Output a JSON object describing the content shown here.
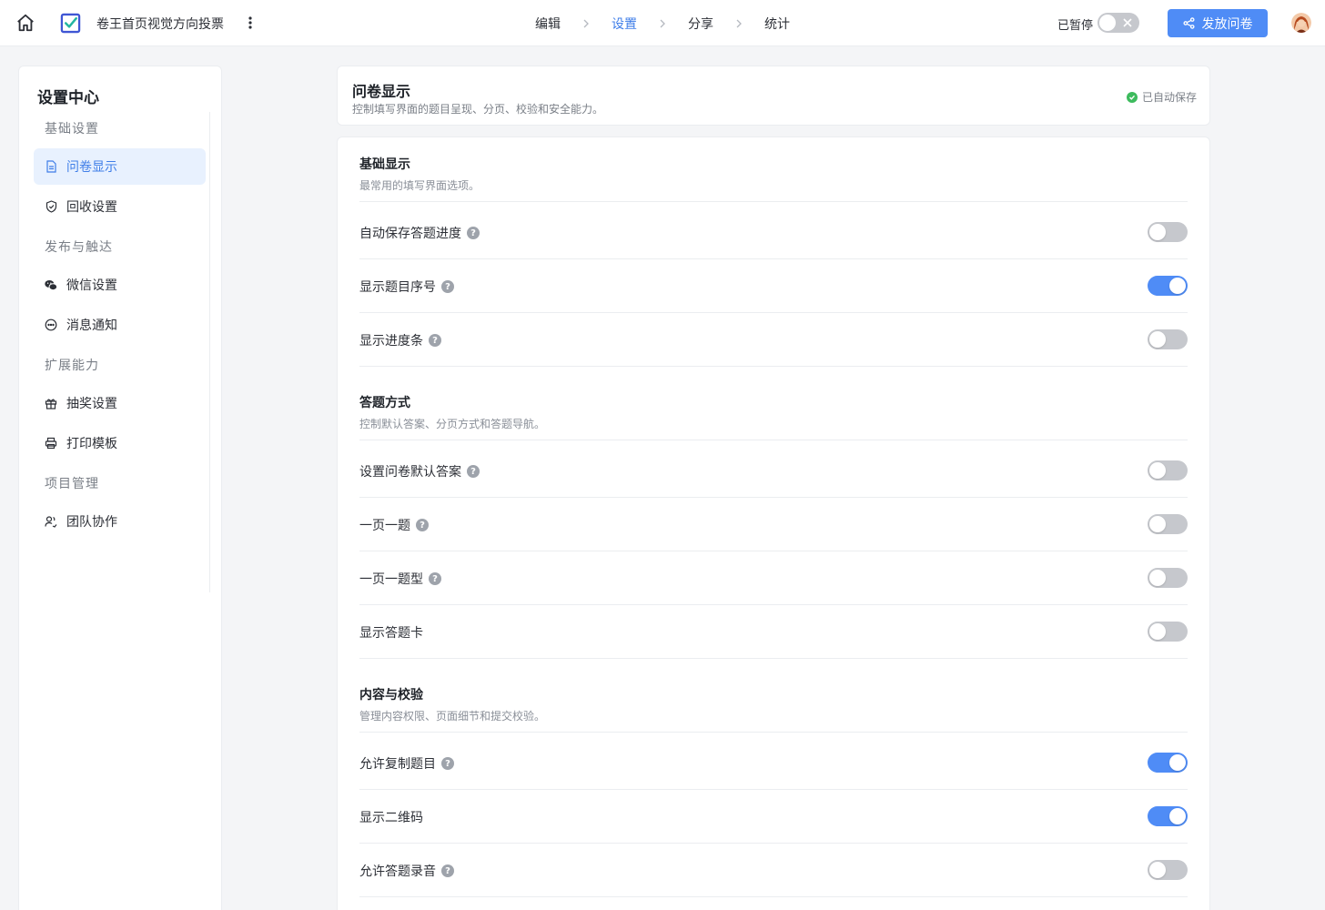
{
  "header": {
    "survey_title": "卷王首页视觉方向投票",
    "steps": [
      "编辑",
      "设置",
      "分享",
      "统计"
    ],
    "active_step": 1,
    "pause_label": "已暂停",
    "pause_on": false,
    "publish_label": "发放问卷",
    "accent_color": "#4f8cf6"
  },
  "sidebar": {
    "title": "设置中心",
    "groups": [
      {
        "label": "基础设置",
        "items": [
          {
            "label": "问卷显示",
            "icon": "document-icon",
            "active": true
          },
          {
            "label": "回收设置",
            "icon": "shield-check-icon",
            "active": false
          }
        ]
      },
      {
        "label": "发布与触达",
        "items": [
          {
            "label": "微信设置",
            "icon": "wechat-icon",
            "active": false
          },
          {
            "label": "消息通知",
            "icon": "message-icon",
            "active": false
          }
        ]
      },
      {
        "label": "扩展能力",
        "items": [
          {
            "label": "抽奖设置",
            "icon": "gift-icon",
            "active": false
          },
          {
            "label": "打印模板",
            "icon": "printer-icon",
            "active": false
          }
        ]
      },
      {
        "label": "项目管理",
        "items": [
          {
            "label": "团队协作",
            "icon": "team-icon",
            "active": false
          }
        ]
      }
    ]
  },
  "main": {
    "title": "问卷显示",
    "description": "控制填写界面的题目呈现、分页、校验和安全能力。",
    "saved_label": "已自动保存",
    "sections": [
      {
        "title": "基础显示",
        "description": "最常用的填写界面选项。",
        "rows": [
          {
            "label": "自动保存答题进度",
            "help": true,
            "on": false
          },
          {
            "label": "显示题目序号",
            "help": true,
            "on": true
          },
          {
            "label": "显示进度条",
            "help": true,
            "on": false
          }
        ]
      },
      {
        "title": "答题方式",
        "description": "控制默认答案、分页方式和答题导航。",
        "rows": [
          {
            "label": "设置问卷默认答案",
            "help": true,
            "on": false
          },
          {
            "label": "一页一题",
            "help": true,
            "on": false
          },
          {
            "label": "一页一题型",
            "help": true,
            "on": false
          },
          {
            "label": "显示答题卡",
            "help": false,
            "on": false
          }
        ]
      },
      {
        "title": "内容与校验",
        "description": "管理内容权限、页面细节和提交校验。",
        "rows": [
          {
            "label": "允许复制题目",
            "help": true,
            "on": true
          },
          {
            "label": "显示二维码",
            "help": false,
            "on": true
          },
          {
            "label": "允许答题录音",
            "help": true,
            "on": false
          }
        ]
      }
    ]
  }
}
